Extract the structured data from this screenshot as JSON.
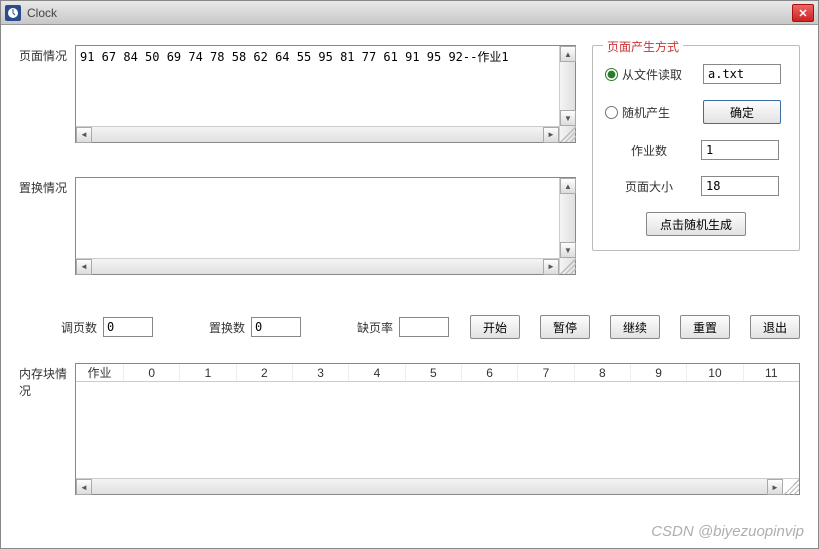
{
  "window": {
    "title": "Clock"
  },
  "page_situation": {
    "label": "页面情况",
    "content": "91 67 84 50 69 74 78 58 62 64 55 95 81 77 61 91 95 92--作业1"
  },
  "replace_situation": {
    "label": "置换情况",
    "content": ""
  },
  "generation": {
    "title": "页面产生方式",
    "radio_file": "从文件读取",
    "radio_random": "随机产生",
    "file_value": "a.txt",
    "confirm": "确定",
    "jobs_label": "作业数",
    "jobs_value": "1",
    "pagesize_label": "页面大小",
    "pagesize_value": "18",
    "random_gen": "点击随机生成"
  },
  "stats": {
    "pages_label": "调页数",
    "pages_value": "0",
    "replaces_label": "置换数",
    "replaces_value": "0",
    "miss_label": "缺页率",
    "miss_value": ""
  },
  "buttons": {
    "start": "开始",
    "pause": "暂停",
    "continue": "继续",
    "reset": "重置",
    "exit": "退出"
  },
  "memory": {
    "label": "内存块情况",
    "headers": [
      "作业",
      "0",
      "1",
      "2",
      "3",
      "4",
      "5",
      "6",
      "7",
      "8",
      "9",
      "10",
      "11"
    ]
  },
  "watermark": "CSDN @biyezuopinvip"
}
